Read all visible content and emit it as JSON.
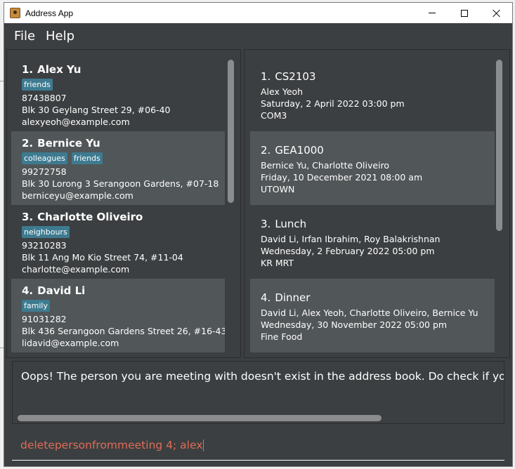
{
  "window": {
    "title": "Address App"
  },
  "menu": {
    "file": "File",
    "help": "Help"
  },
  "persons": [
    {
      "index": "1.",
      "name": "Alex Yu",
      "tags": [
        "friends"
      ],
      "phone": "87438807",
      "address": "Blk 30 Geylang Street 29, #06-40",
      "email": "alexyeoh@example.com"
    },
    {
      "index": "2.",
      "name": "Bernice Yu",
      "tags": [
        "colleagues",
        "friends"
      ],
      "phone": "99272758",
      "address": "Blk 30 Lorong 3 Serangoon Gardens, #07-18",
      "email": "berniceyu@example.com"
    },
    {
      "index": "3.",
      "name": "Charlotte Oliveiro",
      "tags": [
        "neighbours"
      ],
      "phone": "93210283",
      "address": "Blk 11 Ang Mo Kio Street 74, #11-04",
      "email": "charlotte@example.com"
    },
    {
      "index": "4.",
      "name": "David Li",
      "tags": [
        "family"
      ],
      "phone": "91031282",
      "address": "Blk 436 Serangoon Gardens Street 26, #16-43",
      "email": "lidavid@example.com"
    }
  ],
  "meetings": [
    {
      "index": "1.",
      "title": "CS2103",
      "people": "Alex Yeoh",
      "datetime": "Saturday, 2 April 2022 03:00 pm",
      "location": "COM3"
    },
    {
      "index": "2.",
      "title": "GEA1000",
      "people": "Bernice Yu, Charlotte Oliveiro",
      "datetime": "Friday, 10 December 2021 08:00 am",
      "location": "UTOWN"
    },
    {
      "index": "3.",
      "title": "Lunch",
      "people": "David Li, Irfan Ibrahim, Roy Balakrishnan",
      "datetime": "Wednesday, 2 February 2022 05:00 pm",
      "location": "KR MRT"
    },
    {
      "index": "4.",
      "title": "Dinner",
      "people": "David Li, Alex Yeoh, Charlotte Oliveiro, Bernice Yu",
      "datetime": "Wednesday, 30 November 2022 05:00 pm",
      "location": "Fine Food"
    }
  ],
  "result": {
    "message": "Oops! The person you are meeting with doesn't exist in the address book. Do check if you have"
  },
  "command": {
    "value": "deletepersonfrommeeting 4; alex"
  },
  "colors": {
    "background": "#3c3f41",
    "card_alt": "#515658",
    "tag": "#3e7b91",
    "command_text": "#e06c57"
  }
}
